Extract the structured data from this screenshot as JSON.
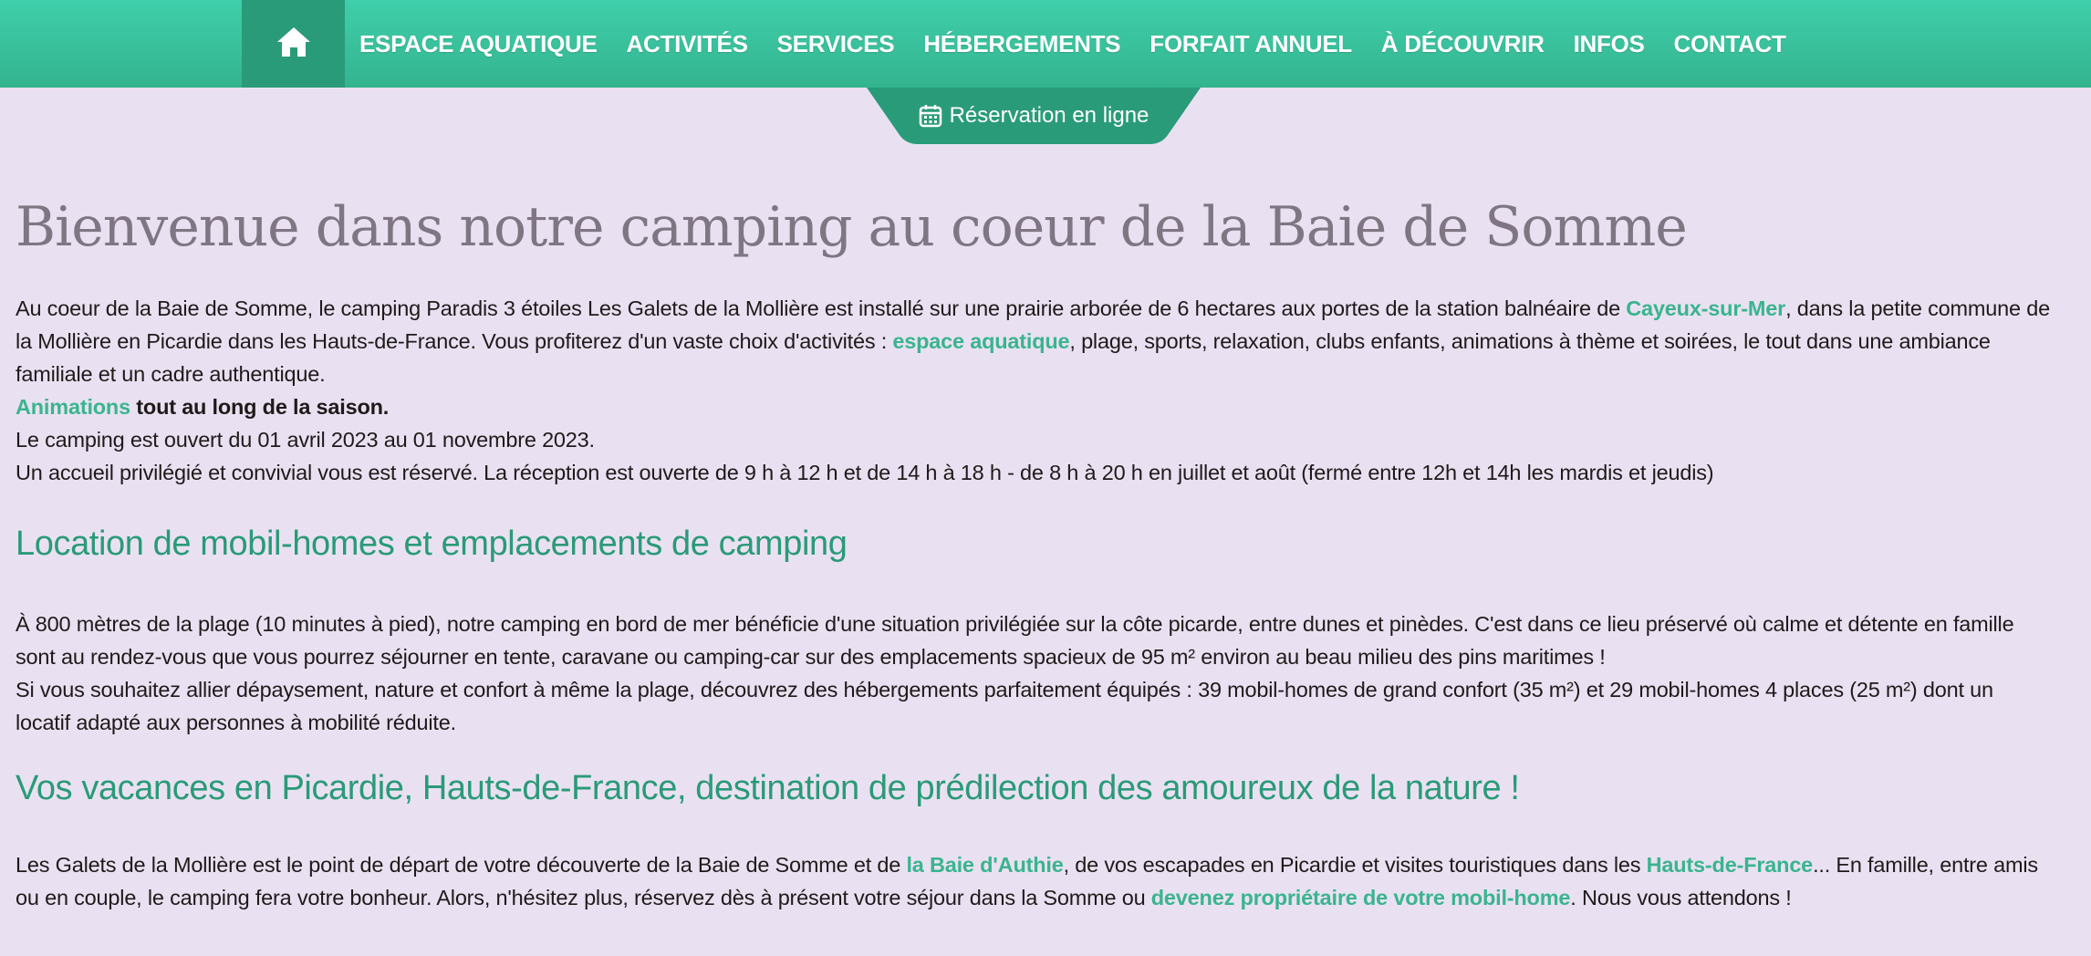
{
  "nav": {
    "home_icon": "home-icon",
    "items": [
      "ESPACE AQUATIQUE",
      "ACTIVITÉS",
      "SERVICES",
      "HÉBERGEMENTS",
      "FORFAIT ANNUEL",
      "À DÉCOUVRIR",
      "INFOS",
      "CONTACT"
    ]
  },
  "reservation": {
    "icon": "calendar-icon",
    "label": "Réservation en ligne"
  },
  "main": {
    "title": "Bienvenue dans notre camping au coeur de la Baie de Somme",
    "intro": {
      "t1": "Au coeur de la Baie de Somme, le camping Paradis 3 étoiles Les Galets de la Mollière est installé sur une prairie arborée de 6 hectares aux portes de la station balnéaire de ",
      "link1": "Cayeux-sur-Mer",
      "t2": ", dans la petite commune de la Mollière en Picardie dans les Hauts-de-France. Vous profiterez d'un vaste choix d'activités : ",
      "link2": "espace aquatique",
      "t3": ", plage, sports, relaxation, clubs enfants, animations à thème et soirées, le tout dans une ambiance familiale et un cadre authentique.",
      "link3": "Animations",
      "bold1": " tout au long de la saison.",
      "line_open": "Le camping est ouvert du 01 avril 2023 au 01 novembre 2023.",
      "line_accueil": "Un accueil privilégié et convivial vous est réservé. La réception est ouverte de 9 h à 12 h et de 14 h à 18 h - de 8 h à 20 h en juillet et août (fermé entre 12h et 14h les mardis et jeudis)"
    },
    "section1": {
      "heading": "Location de mobil-homes et emplacements de camping",
      "p1": "À 800 mètres de la plage (10 minutes à pied), notre camping en bord de mer bénéficie d'une situation privilégiée sur la côte picarde, entre dunes et pinèdes. C'est dans ce lieu préservé où calme et détente en famille sont au rendez-vous que vous pourrez séjourner en tente, caravane ou camping-car sur des emplacements spacieux de 95 m² environ au beau milieu des pins maritimes !",
      "p2": "Si vous souhaitez allier dépaysement, nature et confort à même la plage, découvrez des hébergements parfaitement équipés : 39 mobil-homes de grand confort (35 m²) et 29 mobil-homes 4 places (25 m²) dont un locatif adapté aux personnes à mobilité réduite."
    },
    "section2": {
      "heading": "Vos vacances en Picardie, Hauts-de-France, destination de prédilection des amoureux de la nature !",
      "t1": "Les Galets de la Mollière est le point de départ de votre découverte de la Baie de Somme et de ",
      "link1": "la Baie d'Authie",
      "t2": ", de vos escapades en Picardie et visites touristiques dans les ",
      "link2": "Hauts-de-France",
      "t3": "... En famille, entre amis ou en couple, le camping fera votre bonheur. Alors, n'hésitez plus, réservez dès à présent votre séjour dans la Somme ou ",
      "link3": "devenez propriétaire de votre mobil-home",
      "t4": ". Nous vous attendons !"
    }
  },
  "colors": {
    "nav_top": "#3fcfaa",
    "nav_bottom": "#33b48f",
    "home_bg": "#2a9b79",
    "page_bg": "#e9e1f1",
    "title": "#807683",
    "heading": "#2a9a78",
    "link": "#3ab48f"
  }
}
